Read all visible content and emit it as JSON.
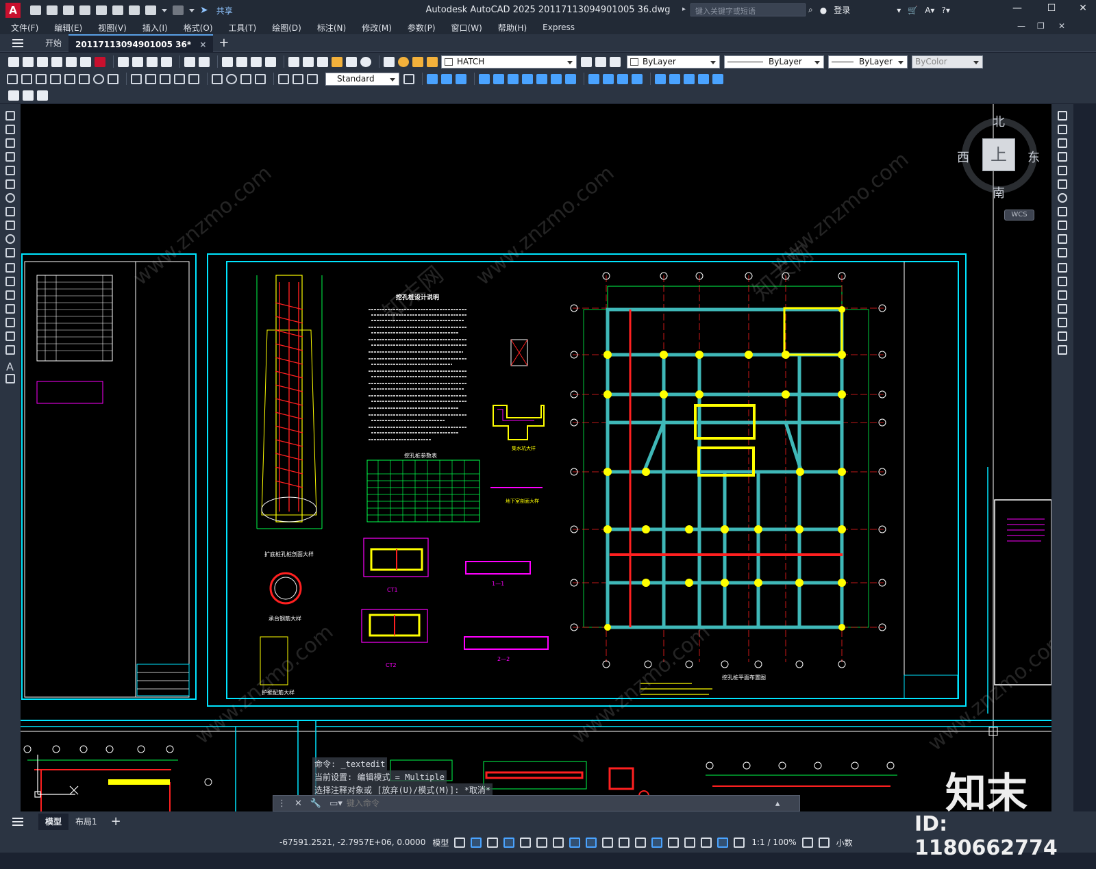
{
  "titlebar": {
    "app_name": "Autodesk AutoCAD 2025",
    "file_name": "20117113094901005 36.dwg",
    "title": "Autodesk AutoCAD 2025    20117113094901005 36.dwg",
    "share_label": "共享",
    "search_placeholder": "键入关键字或短语",
    "login_label": "登录",
    "app_logo": "A"
  },
  "menubar": {
    "items": [
      "文件(F)",
      "编辑(E)",
      "视图(V)",
      "插入(I)",
      "格式(O)",
      "工具(T)",
      "绘图(D)",
      "标注(N)",
      "修改(M)",
      "参数(P)",
      "窗口(W)",
      "帮助(H)",
      "Express"
    ]
  },
  "tabs": {
    "start_label": "开始",
    "active_label": "20117113094901005 36*",
    "close_glyph": "×",
    "add_glyph": "+"
  },
  "toolbar": {
    "layer_value": "HATCH",
    "color_value": "ByLayer",
    "linetype_value": "ByLayer",
    "lineweight_value": "ByLayer",
    "plotstyle_value": "ByColor",
    "dimstyle_value": "Standard"
  },
  "viewcube": {
    "north": "北",
    "south": "南",
    "east": "东",
    "west": "西",
    "top": "上",
    "wcs": "WCS"
  },
  "command": {
    "history": [
      "命令: _textedit",
      "当前设置: 编辑模式 = Multiple",
      "选择注释对象或 [放弃(U)/模式(M)]: *取消*"
    ],
    "placeholder": "键入命令"
  },
  "layout_tabs": {
    "model": "模型",
    "layout1": "布局1",
    "add": "+"
  },
  "statusbar": {
    "coordinates": "-67591.2521, -2.7957E+06, 0.0000",
    "model_label": "模型",
    "scale": "1:1 / 100%",
    "units": "小数"
  },
  "drawing": {
    "notes_title": "挖孔桩设计说明",
    "table_title": "挖孔桩参数表",
    "detail1": "扩底桩孔桩剖面大样",
    "detail2": "承台钢筋大样",
    "detail3": "护壁配筋大样",
    "detail4": "集水坑大样",
    "detail5": "地下室剖面大样",
    "plan_title": "挖孔桩平面布置图",
    "section1": "1—1",
    "section2": "2—2",
    "ct1": "CT1",
    "ct2": "CT2"
  },
  "watermark": {
    "site": "www.znzmo.com",
    "brand": "知末网",
    "logo_text": "知末",
    "id_text": "ID: 1180662774"
  },
  "colors": {
    "background": "#000000",
    "cyan": "#00e5ff",
    "green": "#00ff4c",
    "red": "#ff2020",
    "yellow": "#ffff00",
    "magenta": "#ff00ff",
    "white": "#ffffff",
    "teal": "#3fb8b8"
  }
}
